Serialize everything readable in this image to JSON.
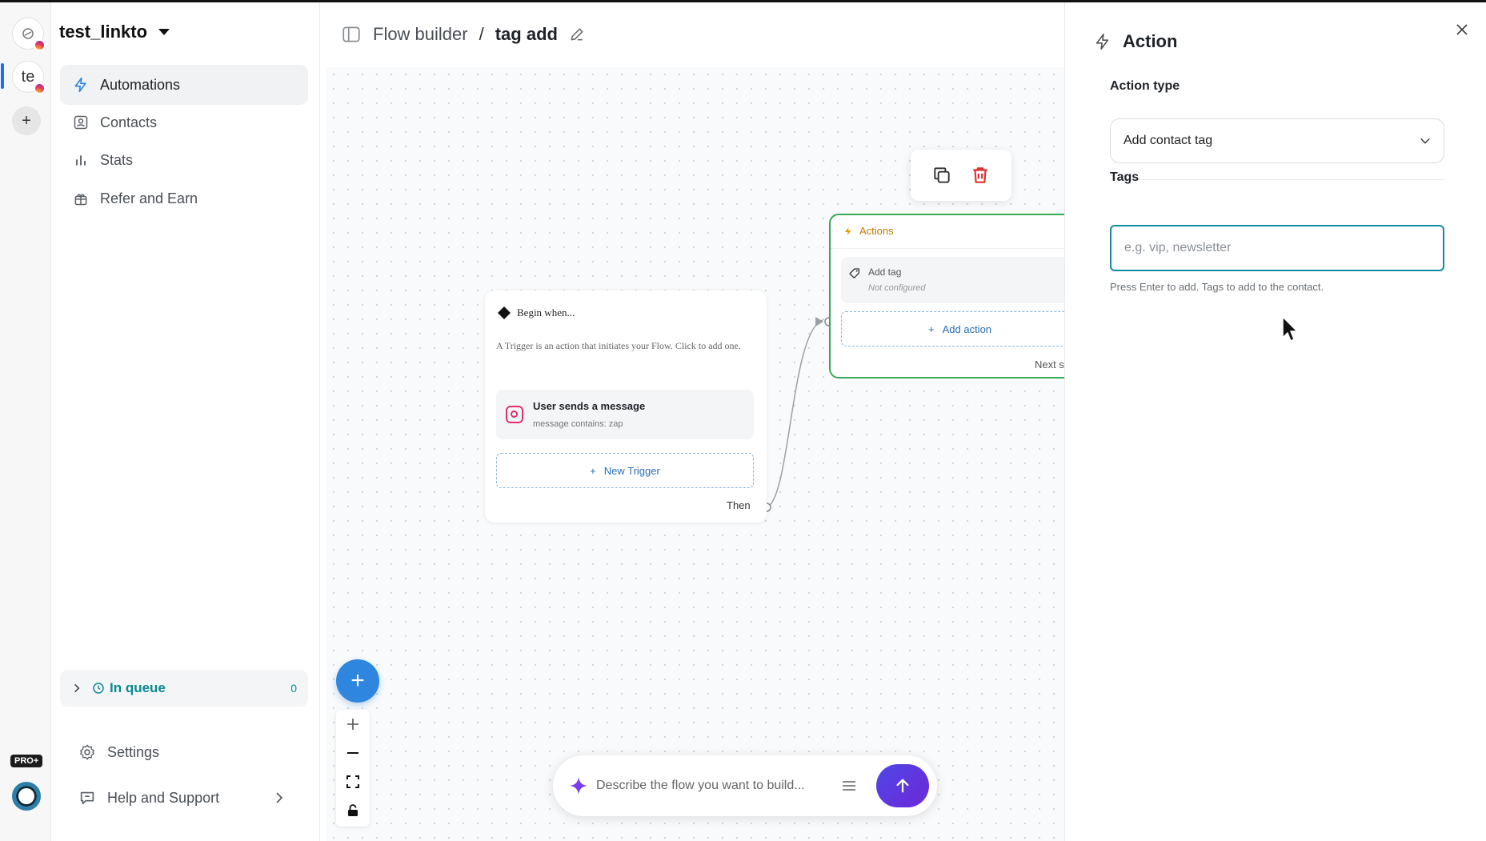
{
  "workspace": {
    "name": "test_linkto"
  },
  "rail": {
    "accounts": [
      {
        "initials": ""
      },
      {
        "initials": "te"
      }
    ],
    "add_label": "+",
    "pro_badge": "PRO+"
  },
  "sidebar": {
    "items": [
      {
        "label": "Automations",
        "icon": "bolt-icon",
        "active": true
      },
      {
        "label": "Contacts",
        "icon": "contact-icon",
        "active": false
      },
      {
        "label": "Stats",
        "icon": "bar-chart-icon",
        "active": false
      },
      {
        "label": "Refer and Earn",
        "icon": "gift-icon",
        "active": false
      }
    ],
    "queue": {
      "label": "In queue",
      "count": "0"
    },
    "settings_label": "Settings",
    "help_label": "Help and Support"
  },
  "header": {
    "breadcrumb_parent": "Flow builder",
    "separator": "/",
    "flow_name": "tag add"
  },
  "canvas": {
    "trigger_node": {
      "title": "Begin when...",
      "description": "A Trigger is an action that initiates your Flow. Click to add one.",
      "trigger_title": "User sends a message",
      "trigger_subtitle": "message contains: zap",
      "new_trigger_label": "New Trigger",
      "then_label": "Then"
    },
    "actions_node": {
      "title": "Actions",
      "action_title": "Add tag",
      "action_status": "Not configured",
      "add_action_label": "Add action",
      "next_label": "Next s"
    },
    "prompt": {
      "placeholder": "Describe the flow you want to build..."
    }
  },
  "panel": {
    "title": "Action",
    "action_type_label": "Action type",
    "action_type_value": "Add contact tag",
    "tags_label": "Tags",
    "tags_placeholder": "e.g. vip, newsletter",
    "tags_help": "Press Enter to add. Tags to add to the contact."
  },
  "colors": {
    "accent": "#2e86de",
    "actions_border": "#3aa757",
    "tags_focus": "#148a9c",
    "queue": "#0a8a92",
    "delete": "#e03131"
  }
}
